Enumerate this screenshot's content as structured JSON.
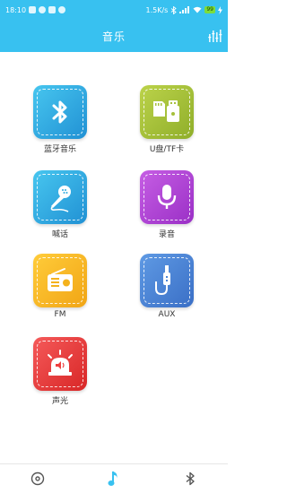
{
  "status_bar": {
    "time": "18:10",
    "network_speed": "1.5K/s",
    "battery": "99"
  },
  "header": {
    "title": "音乐",
    "right_icon": "equalizer-icon"
  },
  "grid": {
    "items": [
      {
        "label": "蓝牙音乐",
        "icon": "bluetooth-icon",
        "color": "#2fa9df"
      },
      {
        "label": "U盘/TF卡",
        "icon": "usb-tf-icon",
        "color": "#a6c03a"
      },
      {
        "label": "喊话",
        "icon": "microphone-icon",
        "color": "#2fa9df"
      },
      {
        "label": "录音",
        "icon": "record-mic-icon",
        "color": "#b247d6"
      },
      {
        "label": "FM",
        "icon": "radio-icon",
        "color": "#f4b21c"
      },
      {
        "label": "AUX",
        "icon": "aux-cable-icon",
        "color": "#4b84d6"
      },
      {
        "label": "声光",
        "icon": "alarm-light-icon",
        "color": "#ef3f3f"
      }
    ]
  },
  "bottom_nav": {
    "items": [
      {
        "icon": "disc-icon",
        "active": false
      },
      {
        "icon": "music-note-icon",
        "active": true
      },
      {
        "icon": "bluetooth-icon",
        "active": false
      }
    ],
    "active_color": "#38c1f0",
    "inactive_color": "#555555"
  }
}
